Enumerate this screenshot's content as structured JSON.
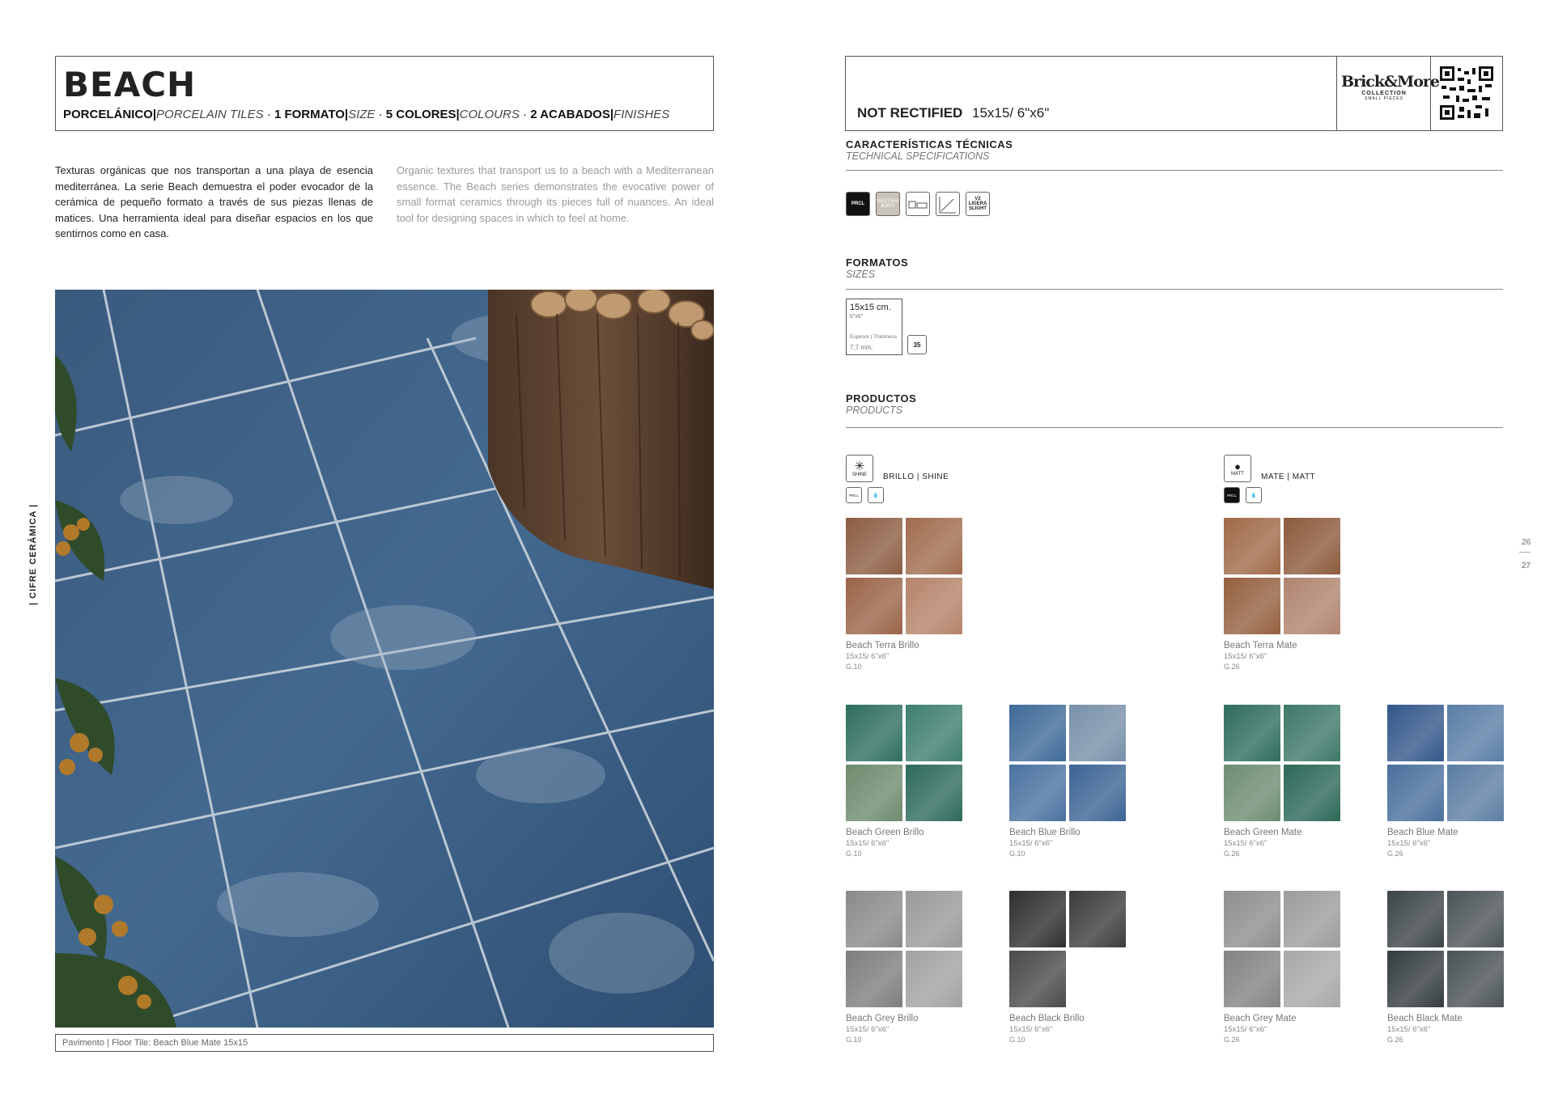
{
  "header": {
    "title": "BEACH",
    "sub": [
      {
        "text": "PORCELÁNICO",
        "style": "b"
      },
      {
        "text": "|",
        "style": "b"
      },
      {
        "text": "PORCELAIN TILES",
        "style": "i"
      },
      {
        "text": " · ",
        "style": ""
      },
      {
        "text": "1 FORMATO",
        "style": "b"
      },
      {
        "text": "|",
        "style": "b"
      },
      {
        "text": "SIZE",
        "style": "i"
      },
      {
        "text": " · ",
        "style": ""
      },
      {
        "text": "5 COLORES",
        "style": "b"
      },
      {
        "text": "|",
        "style": "b"
      },
      {
        "text": "COLOURS",
        "style": "i"
      },
      {
        "text": " · ",
        "style": ""
      },
      {
        "text": "2 ACABADOS",
        "style": "b"
      },
      {
        "text": "|",
        "style": "b"
      },
      {
        "text": "FINISHES",
        "style": "i"
      }
    ]
  },
  "description": {
    "es": "Texturas orgánicas que nos transportan a una playa de esencia mediterránea. La serie Beach demuestra el poder evocador de la cerámica de pequeño formato a través de sus piezas llenas de matices. Una herramienta ideal para diseñar espacios en los que sentirnos como en casa.",
    "en": "Organic textures that transport us to a beach with a Mediterranean essence. The Beach series demonstrates the evocative power of small format ceramics through its pieces full of nuances. An ideal tool for designing spaces in which to feel at home."
  },
  "photo_caption": "Pavimento | Floor Tile: Beach Blue Mate 15x15",
  "side_label": "| CIFRE CERÁMICA |",
  "right_header": {
    "rectified": "NOT RECTIFIED",
    "size": "15x15/ 6\"x6\"",
    "logo_line1": "Brick&More",
    "logo_line2": "COLLECTION",
    "logo_line3": "SMALL PIECES"
  },
  "tech": {
    "title": "CARACTERÍSTICAS TÉCNICAS",
    "subtitle": "TECHNICAL SPECIFICATIONS",
    "icons": [
      "PRCL",
      "NEUTRAL BODY",
      "",
      "ZMMK",
      "V2 LIGERA SLIGHT"
    ]
  },
  "formats": {
    "title": "FORMATOS",
    "subtitle": "SIZES",
    "size": "15x15 cm.",
    "size_in": "6\"x6\"",
    "thickness_label": "Espesor | Thickness",
    "thickness": "7,7 mm.",
    "pieces": "35"
  },
  "products": {
    "title": "PRODUCTOS",
    "subtitle": "PRODUCTS",
    "shine_label": "BRILLO | SHINE",
    "matt_label": "MATE | MATT",
    "shine_icon": "SHINE",
    "matt_icon": "MATT",
    "prcl": "PRCL",
    "items": [
      {
        "name": "Beach Terra Brillo",
        "size": "15x15/ 6\"x6\"",
        "code": "G.10",
        "colors": [
          "#8c5d43",
          "#a06c4e",
          "#9a6448",
          "#b5836a"
        ]
      },
      {
        "name": "Beach Terra Mate",
        "size": "15x15/ 6\"x6\"",
        "code": "G.26",
        "colors": [
          "#a06a48",
          "#8c5a3c",
          "#94603f",
          "#b08470"
        ]
      },
      {
        "name": "Beach Green Brillo",
        "size": "15x15/ 6\"x6\"",
        "code": "G.10",
        "colors": [
          "#2f6e60",
          "#3e7e70",
          "#6e8a6e",
          "#2e6a5c"
        ]
      },
      {
        "name": "Beach Blue Brillo",
        "size": "15x15/ 6\"x6\"",
        "code": "G.10",
        "colors": [
          "#3f6a98",
          "#7890a8",
          "#4a72a0",
          "#3c6494"
        ]
      },
      {
        "name": "Beach Green Mate",
        "size": "15x15/ 6\"x6\"",
        "code": "G.26",
        "colors": [
          "#2f6d5e",
          "#3e7868",
          "#6e8c72",
          "#2c6858"
        ]
      },
      {
        "name": "Beach Blue Mate",
        "size": "15x15/ 6\"x6\"",
        "code": "G.26",
        "colors": [
          "#33578a",
          "#5a7ea6",
          "#4a6f9c",
          "#5c7ea2"
        ]
      },
      {
        "name": "Beach Grey Brillo",
        "size": "15x15/ 6\"x6\"",
        "code": "G.10",
        "colors": [
          "#8a8a8a",
          "#9a9a9a",
          "#7e7e7e",
          "#a2a2a2"
        ]
      },
      {
        "name": "Beach Black Brillo",
        "size": "15x15/ 6\"x6\"",
        "code": "G.10",
        "colors": [
          "#2e2e2e",
          "#3c3c3c",
          "#4a4a4a",
          "#555"
        ]
      },
      {
        "name": "Beach Grey Mate",
        "size": "15x15/ 6\"x6\"",
        "code": "G.26",
        "colors": [
          "#8e8e8e",
          "#9c9c9c",
          "#838383",
          "#a8a8a8"
        ]
      },
      {
        "name": "Beach Black Mate",
        "size": "15x15/ 6\"x6\"",
        "code": "G.26",
        "colors": [
          "#3c4448",
          "#4c5458",
          "#343c40",
          "#4a5256"
        ]
      }
    ]
  },
  "page_numbers": [
    "26",
    "27"
  ]
}
